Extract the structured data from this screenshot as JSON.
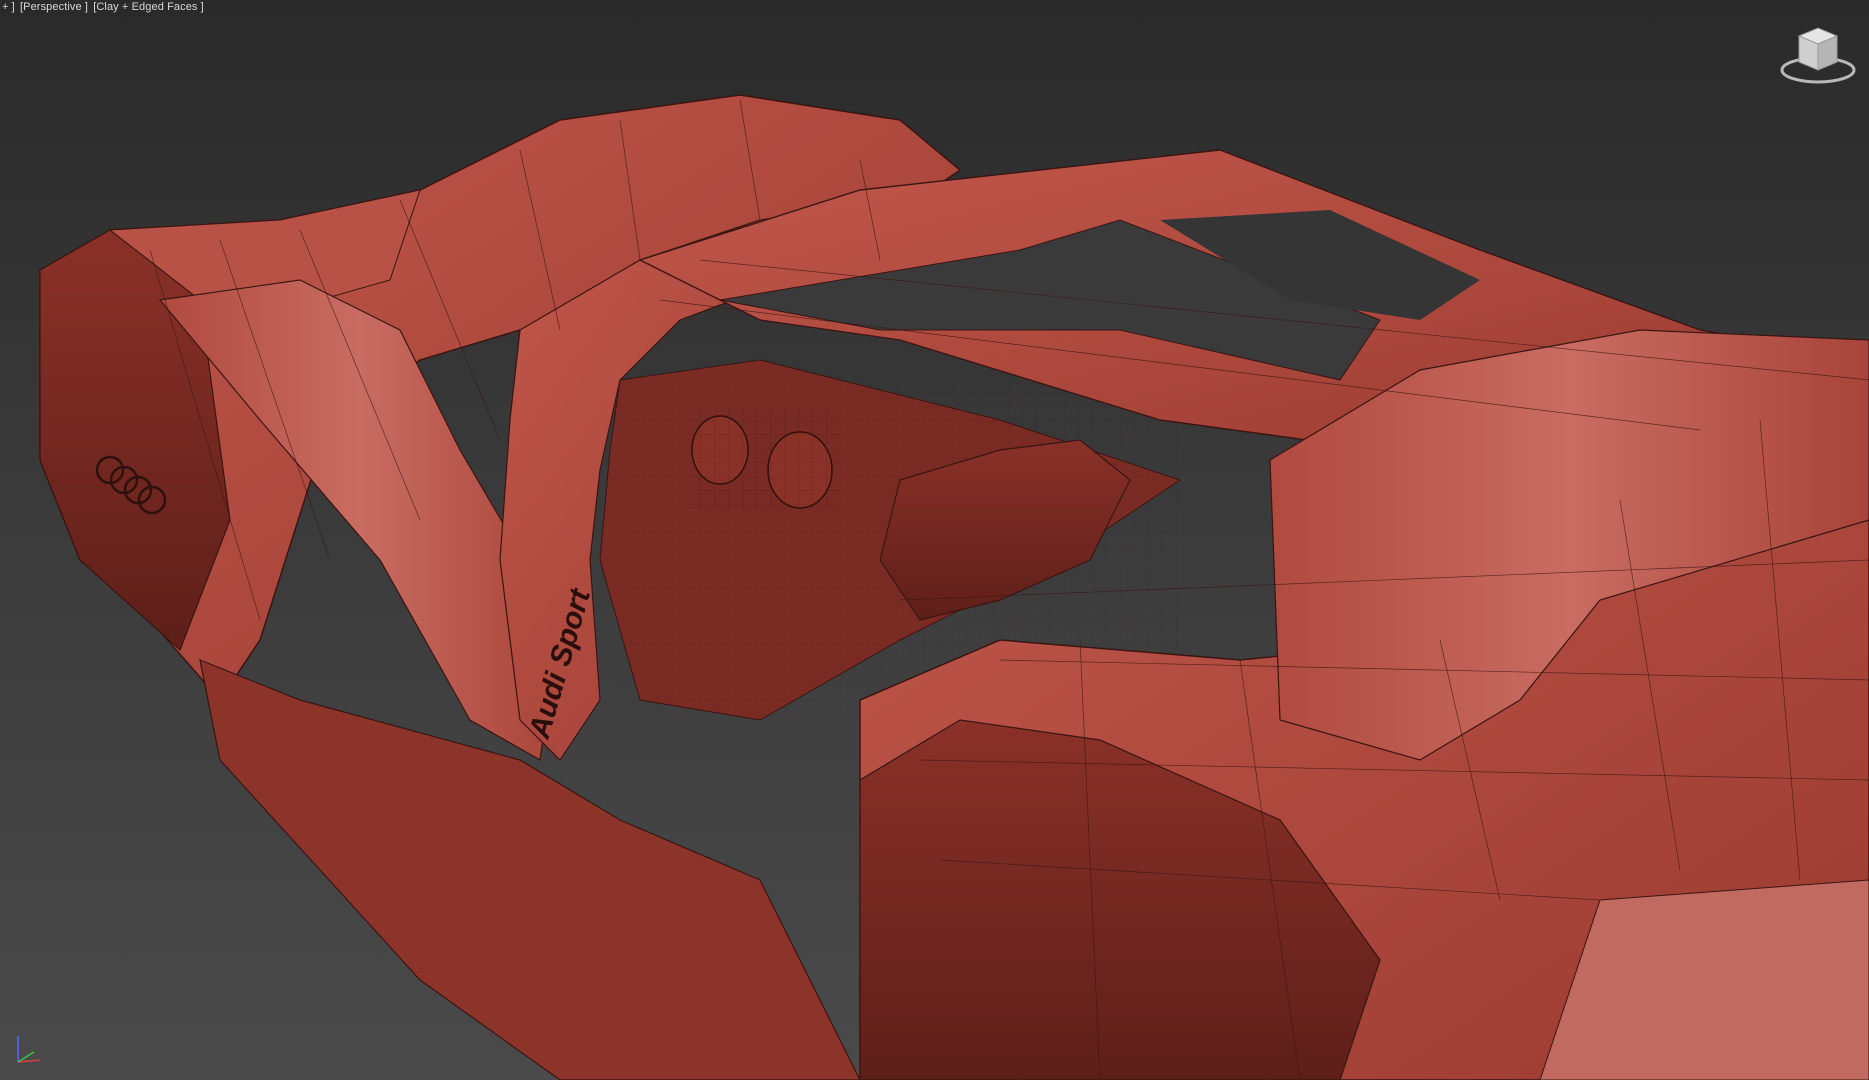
{
  "viewport": {
    "label": {
      "plus": "+ ]",
      "view": "[Perspective ]",
      "shading": "[Clay + Edged Faces ]"
    },
    "background_top": "#2a2a2a",
    "background_bottom": "#4a4a4a"
  },
  "model": {
    "badge_text": "Audi Sport",
    "logo": "audi-four-rings",
    "clay_color": "#b24a3e",
    "clay_dark": "#7a2a22",
    "clay_light": "#c8645a",
    "edge_color": "#3a1512"
  },
  "icons": {
    "viewcube": "viewcube-icon",
    "axis": "axis-tripod-icon"
  }
}
